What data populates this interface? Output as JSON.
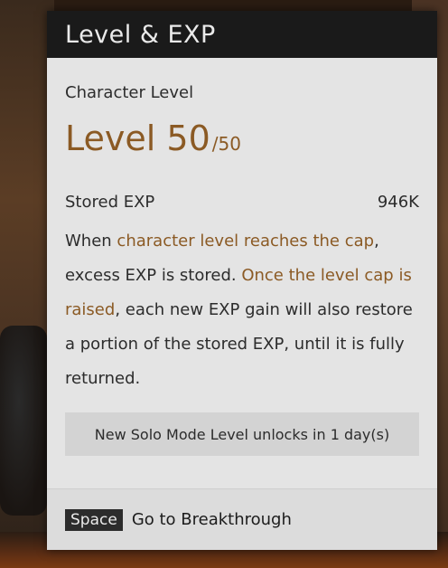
{
  "panel": {
    "title": "Level & EXP",
    "character_level_label": "Character Level",
    "level_text": "Level 50",
    "level_max": "/50",
    "stored_exp_label": "Stored EXP",
    "stored_exp_value": "946K",
    "description": {
      "p1": "When ",
      "h1": "character level reaches the cap",
      "p2": ", excess EXP is stored. ",
      "h2": "Once the level cap is raised",
      "p3": ", each new EXP gain will also restore a portion of the stored EXP, until it is fully returned."
    },
    "notice": "New Solo Mode Level unlocks in 1 day(s)"
  },
  "footer": {
    "key_label": "Space",
    "action_label": "Go to Breakthrough"
  },
  "colors": {
    "accent": "#8b5a24",
    "header_bg": "#1a1a1a",
    "panel_bg": "#e4e4e4"
  }
}
